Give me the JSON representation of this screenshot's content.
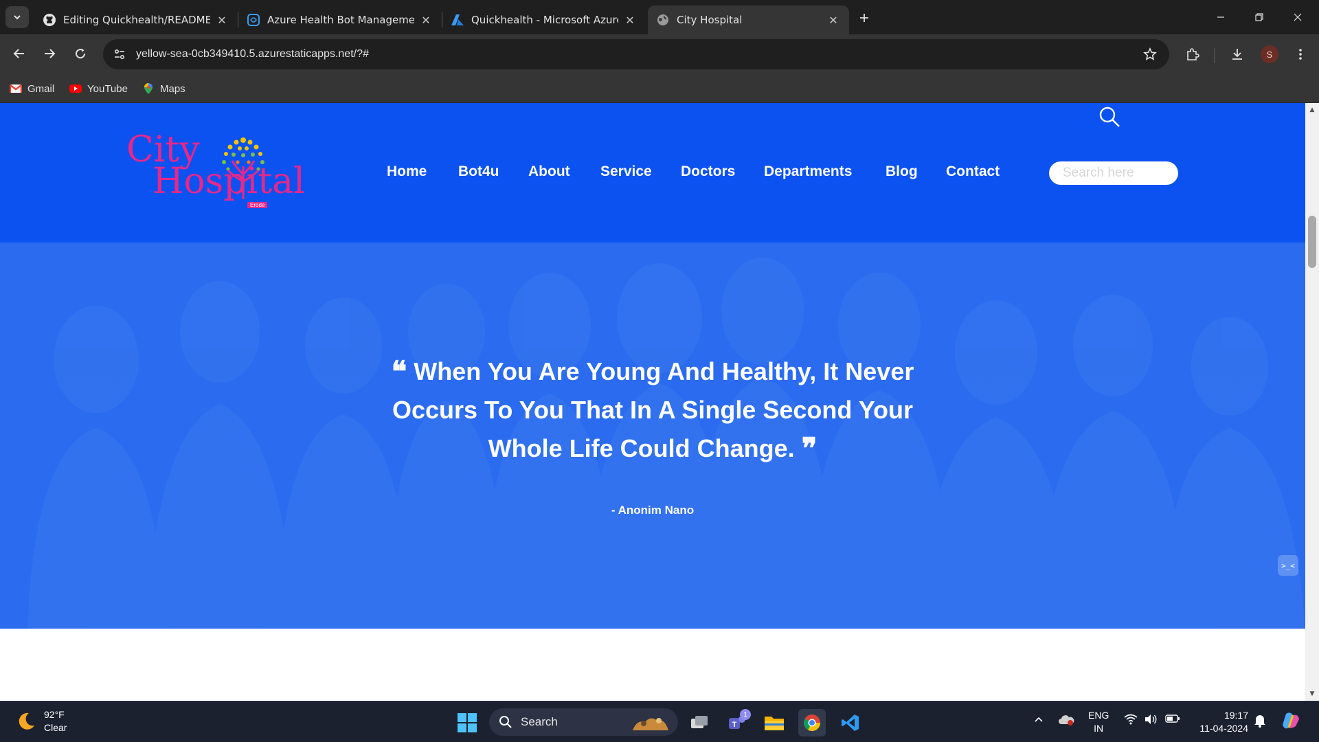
{
  "browser": {
    "tabs": [
      {
        "title": "Editing Quickhealth/README.m",
        "icon": "github-icon"
      },
      {
        "title": "Azure Health Bot Management",
        "icon": "health-bot-icon"
      },
      {
        "title": "Quickhealth - Microsoft Azure",
        "icon": "azure-icon"
      },
      {
        "title": "City Hospital",
        "icon": "globe-icon",
        "active": true
      }
    ],
    "url": "yellow-sea-0cb349410.5.azurestaticapps.net/?#",
    "profile_initial": "S",
    "bookmarks": [
      {
        "label": "Gmail",
        "icon": "gmail-icon"
      },
      {
        "label": "YouTube",
        "icon": "youtube-icon"
      },
      {
        "label": "Maps",
        "icon": "maps-icon"
      }
    ]
  },
  "site": {
    "logo": {
      "line1": "City",
      "line2": "Hospital",
      "sub": "Erode"
    },
    "nav": [
      "Home",
      "Bot4u",
      "About",
      "Service",
      "Doctors",
      "Departments",
      "Blog",
      "Contact"
    ],
    "search_placeholder": "Search here",
    "hero": {
      "quote_open": "❝",
      "quote": "When You Are Young And Healthy, It Never Occurs To You That In A Single Second Your Whole Life Could Change.",
      "quote_close": "❞",
      "author": "- Anonim Nano"
    },
    "colors": {
      "header": "#0b52f0",
      "hero": "#2a6bf0",
      "logo": "#e8278a"
    }
  },
  "taskbar": {
    "weather": {
      "temp": "92°F",
      "condition": "Clear"
    },
    "search_label": "Search",
    "teams_badge": "1",
    "lang": {
      "line1": "ENG",
      "line2": "IN"
    },
    "time": "19:17",
    "date": "11-04-2024"
  }
}
